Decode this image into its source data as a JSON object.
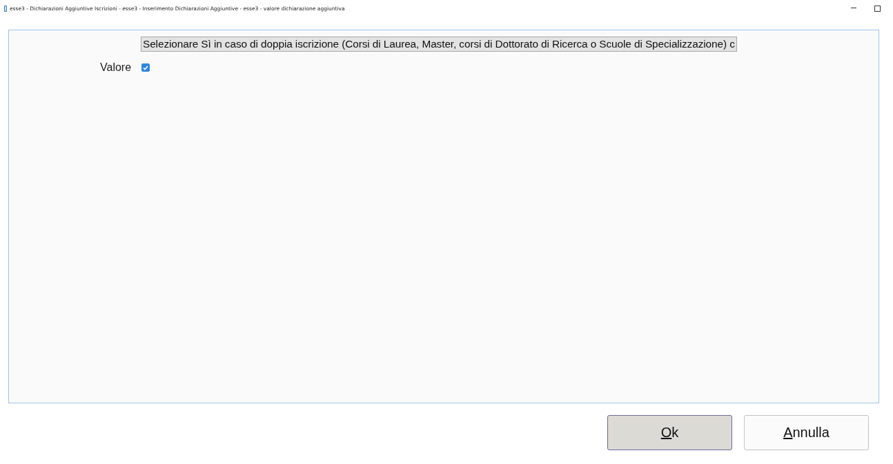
{
  "window": {
    "title": "esse3 - Dichiarazioni Aggiuntive Iscrizioni - esse3 - Inserimento Dichiarazioni Aggiuntive - esse3 - valore  dichiarazione aggiuntiva"
  },
  "form": {
    "description": "Selezionare Sì in caso di doppia iscrizione (Corsi di Laurea, Master, corsi di Dottorato di Ricerca o Scuole di Specializzazione) c",
    "field_label": "Valore",
    "checked": true
  },
  "buttons": [
    {
      "label": "Ok",
      "underline_first": true,
      "selected": true
    },
    {
      "label": "Annulla",
      "underline_first": true,
      "selected": false
    }
  ]
}
